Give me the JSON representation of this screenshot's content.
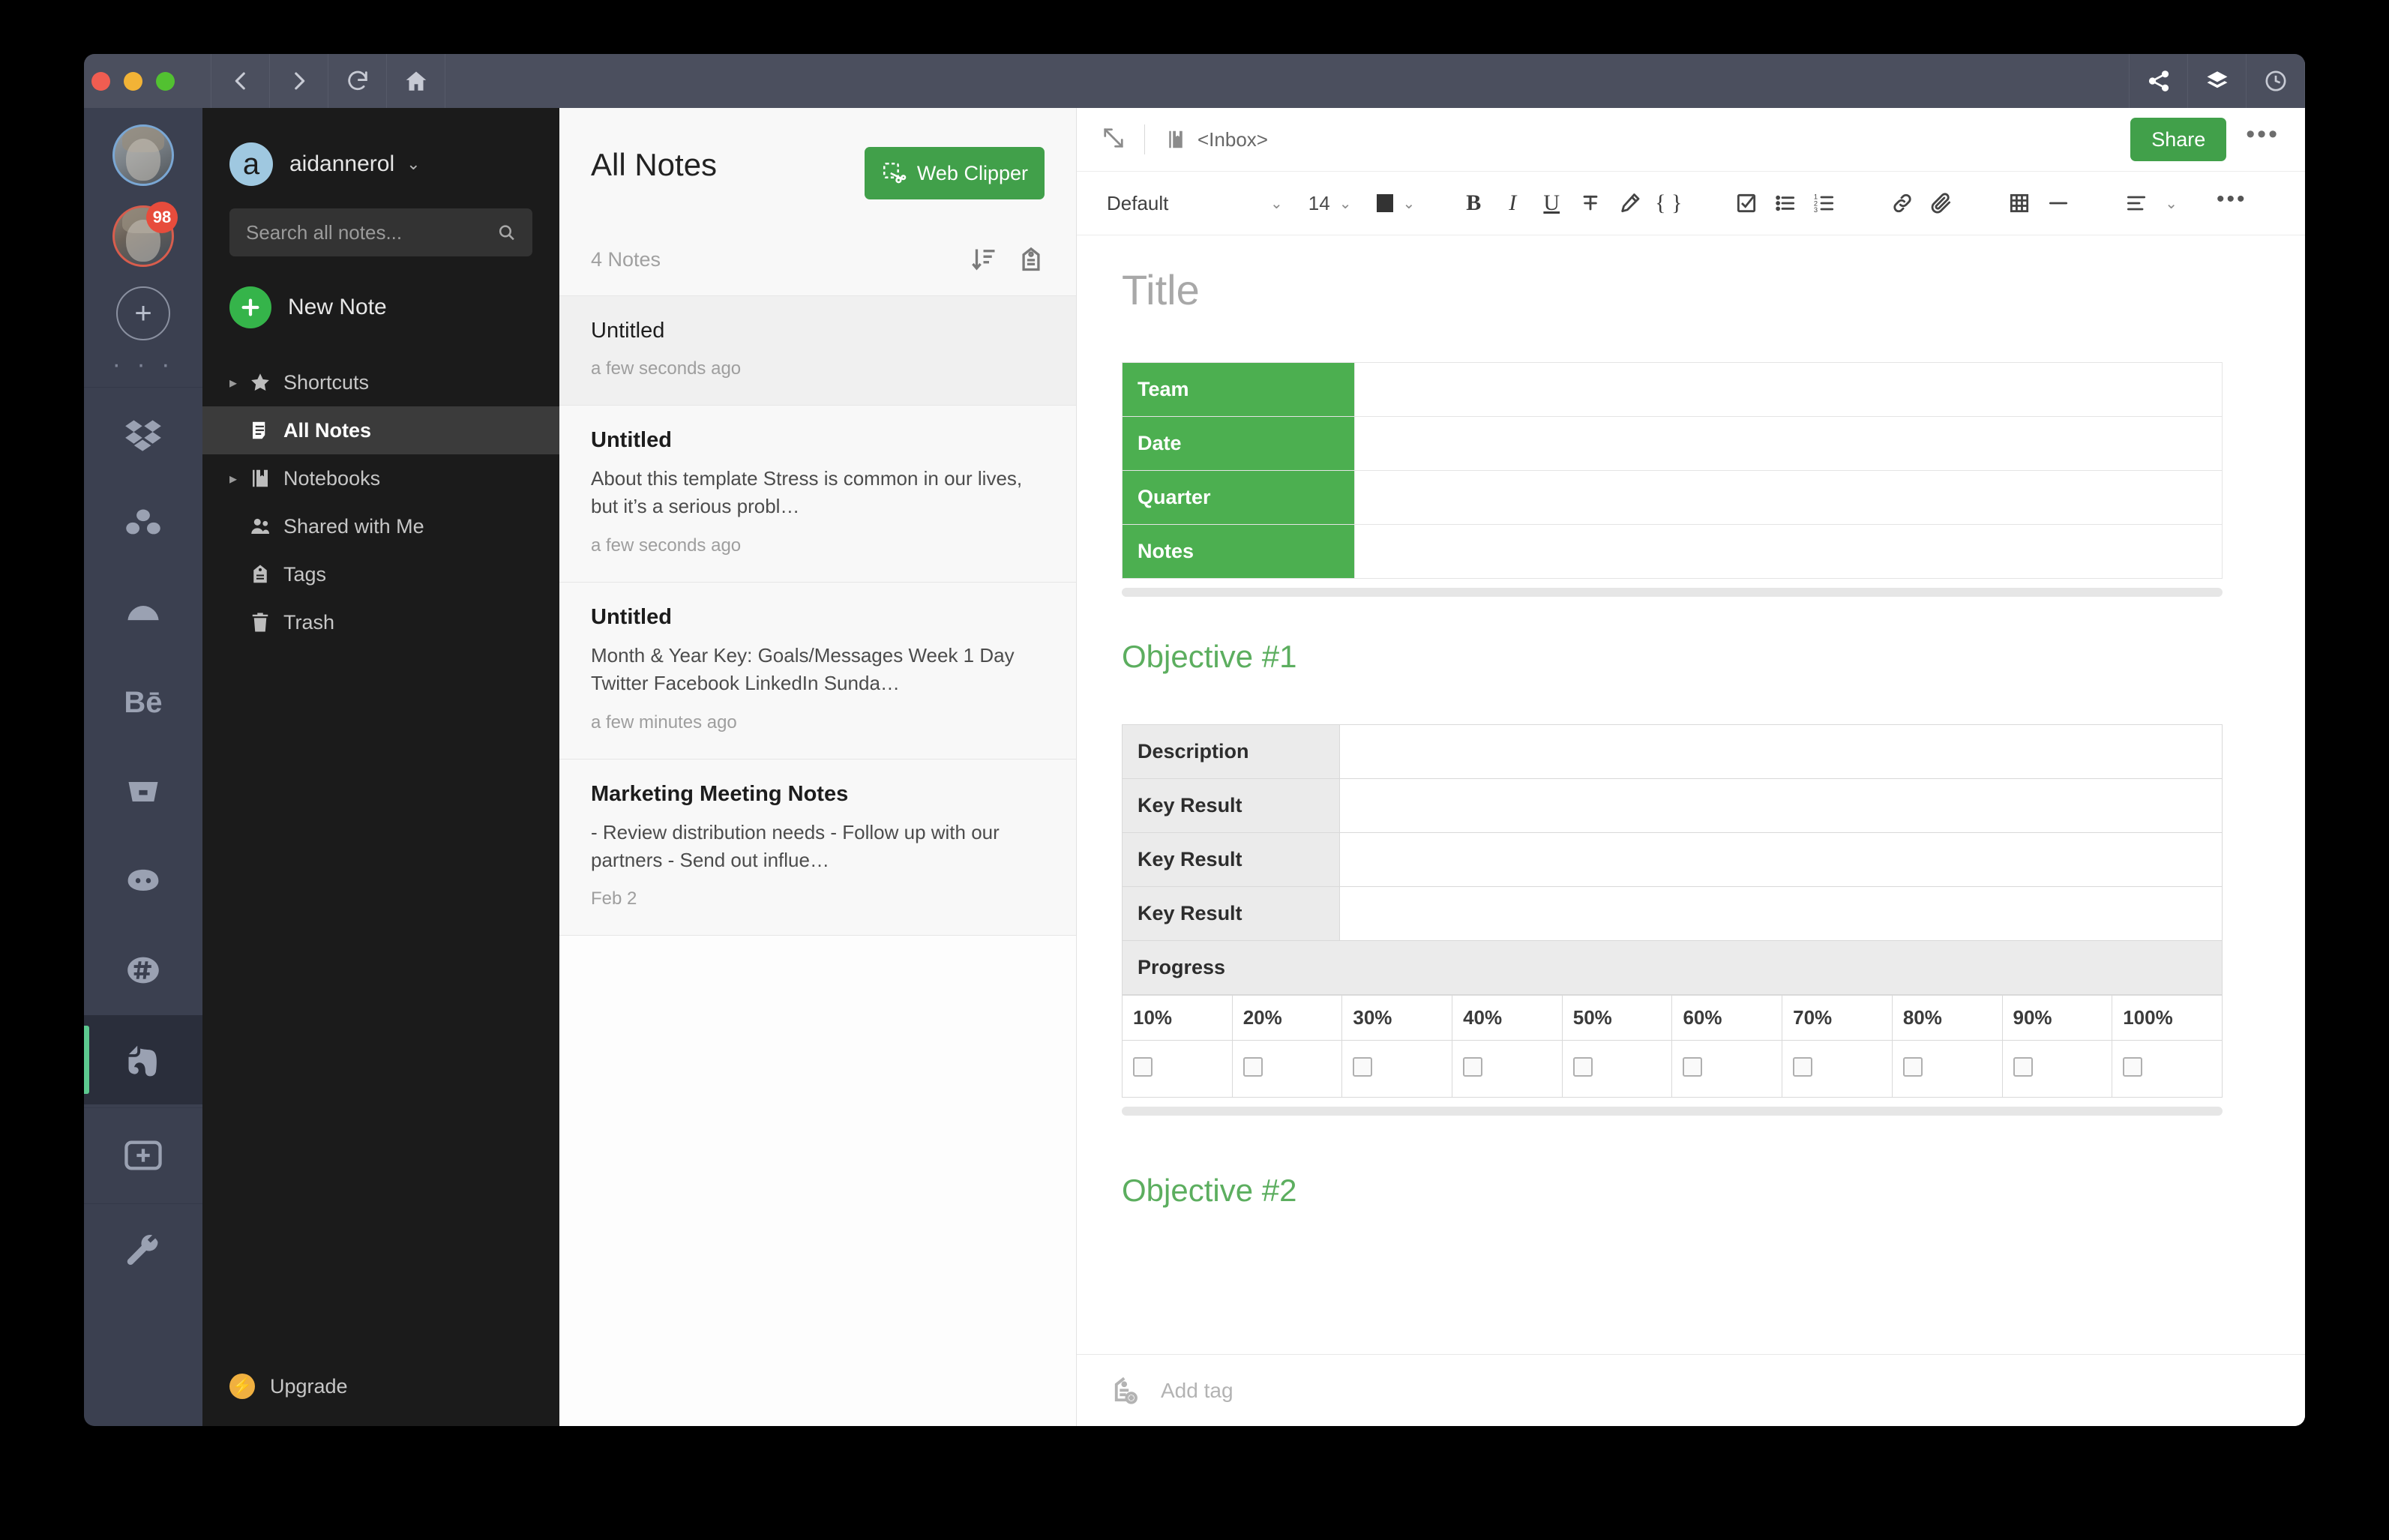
{
  "titlebar": {
    "lights": [
      "close",
      "minimize",
      "maximize"
    ],
    "nav": [
      "back-icon",
      "forward-icon",
      "reload-icon",
      "home-icon"
    ],
    "right": [
      "share-icon",
      "layers-icon",
      "history-icon"
    ]
  },
  "dock": {
    "avatars": [
      {
        "name": "avatar-primary",
        "badge": ""
      },
      {
        "name": "avatar-secondary",
        "badge": "98"
      }
    ],
    "add_label": "+",
    "dots": "· · ·",
    "apps": [
      {
        "name": "dropbox",
        "active": false
      },
      {
        "name": "asana",
        "active": false
      },
      {
        "name": "cloud",
        "active": false
      },
      {
        "name": "behance",
        "label": "Bē",
        "active": false
      },
      {
        "name": "bucket",
        "active": false
      },
      {
        "name": "discord",
        "active": false
      },
      {
        "name": "slack",
        "active": false
      },
      {
        "name": "evernote",
        "active": true
      }
    ],
    "add_app_label": "+",
    "settings": "wrench"
  },
  "sidebar": {
    "account": {
      "avatar_letter": "a",
      "name": "aidannerol",
      "caret": "⌄"
    },
    "search": {
      "placeholder": "Search all notes...",
      "value": ""
    },
    "new_note_label": "New Note",
    "items": [
      {
        "label": "Shortcuts",
        "icon": "star-icon",
        "expandable": true,
        "active": false
      },
      {
        "label": "All Notes",
        "icon": "notes-icon",
        "expandable": false,
        "active": true
      },
      {
        "label": "Notebooks",
        "icon": "notebook-icon",
        "expandable": true,
        "active": false
      },
      {
        "label": "Shared with Me",
        "icon": "people-icon",
        "expandable": false,
        "active": false
      },
      {
        "label": "Tags",
        "icon": "tag-icon",
        "expandable": false,
        "active": false
      },
      {
        "label": "Trash",
        "icon": "trash-icon",
        "expandable": false,
        "active": false
      }
    ],
    "upgrade_label": "Upgrade"
  },
  "notelist": {
    "title": "All Notes",
    "web_clipper_label": "Web Clipper",
    "count_label": "4 Notes",
    "sort_icon": "sort-descending-icon",
    "tag_icon": "tag-icon",
    "notes": [
      {
        "title": "Untitled",
        "snippet": "",
        "time": "a few seconds ago",
        "selected": true
      },
      {
        "title": "Untitled",
        "snippet": "About this template Stress is common in our lives, but it’s a serious probl…",
        "time": "a few seconds ago",
        "selected": false
      },
      {
        "title": "Untitled",
        "snippet": "Month & Year Key: Goals/Messages Week 1 Day Twitter Facebook LinkedIn Sunda…",
        "time": "a few minutes ago",
        "selected": false
      },
      {
        "title": "Marketing Meeting Notes",
        "snippet": "- Review distribution needs - Follow up with our partners - Send out influe…",
        "time": "Feb 2",
        "selected": false
      }
    ]
  },
  "editor": {
    "notebook_label": "<Inbox>",
    "share_label": "Share",
    "more_label": "•••",
    "toolbar": {
      "style": "Default",
      "style_caret": "⌄",
      "font_size": "14",
      "font_size_caret": "⌄",
      "color_caret": "⌄",
      "bold": "B",
      "italic": "I",
      "underline": "U",
      "strikethrough": "strikethrough-icon",
      "highlight": "highlighter-icon",
      "code": "{ }",
      "checklist": "checklist-icon",
      "bullet_list": "bullet-list-icon",
      "numbered_list": "numbered-list-icon",
      "link": "link-icon",
      "attachment": "paperclip-icon",
      "table": "table-icon",
      "divider": "horizontal-rule-icon",
      "align": "align-left-icon",
      "align_caret": "⌄",
      "more": "•••"
    },
    "title_placeholder": "Title",
    "meta_table": {
      "rows": [
        {
          "label": "Team",
          "value": ""
        },
        {
          "label": "Date",
          "value": ""
        },
        {
          "label": "Quarter",
          "value": ""
        },
        {
          "label": "Notes",
          "value": ""
        }
      ]
    },
    "objective1": {
      "heading": "Objective #1",
      "rows": [
        {
          "label": "Description",
          "value": ""
        },
        {
          "label": "Key Result",
          "value": ""
        },
        {
          "label": "Key Result",
          "value": ""
        },
        {
          "label": "Key Result",
          "value": ""
        }
      ],
      "progress_label": "Progress",
      "progress_steps": [
        "10%",
        "20%",
        "30%",
        "40%",
        "50%",
        "60%",
        "70%",
        "80%",
        "90%",
        "100%"
      ],
      "progress_checked": [
        false,
        false,
        false,
        false,
        false,
        false,
        false,
        false,
        false,
        false
      ]
    },
    "objective2": {
      "heading": "Objective #2"
    },
    "tagbar": {
      "icon": "add-tag-icon",
      "placeholder": "Add tag"
    }
  },
  "colors": {
    "evernote_green": "#41a04a",
    "table_green": "#4caf50",
    "heading_green": "#5cae5f",
    "accent_bar": "#5cc98f",
    "badge_red": "#e74c3c",
    "upgrade_amber": "#f0b040"
  }
}
